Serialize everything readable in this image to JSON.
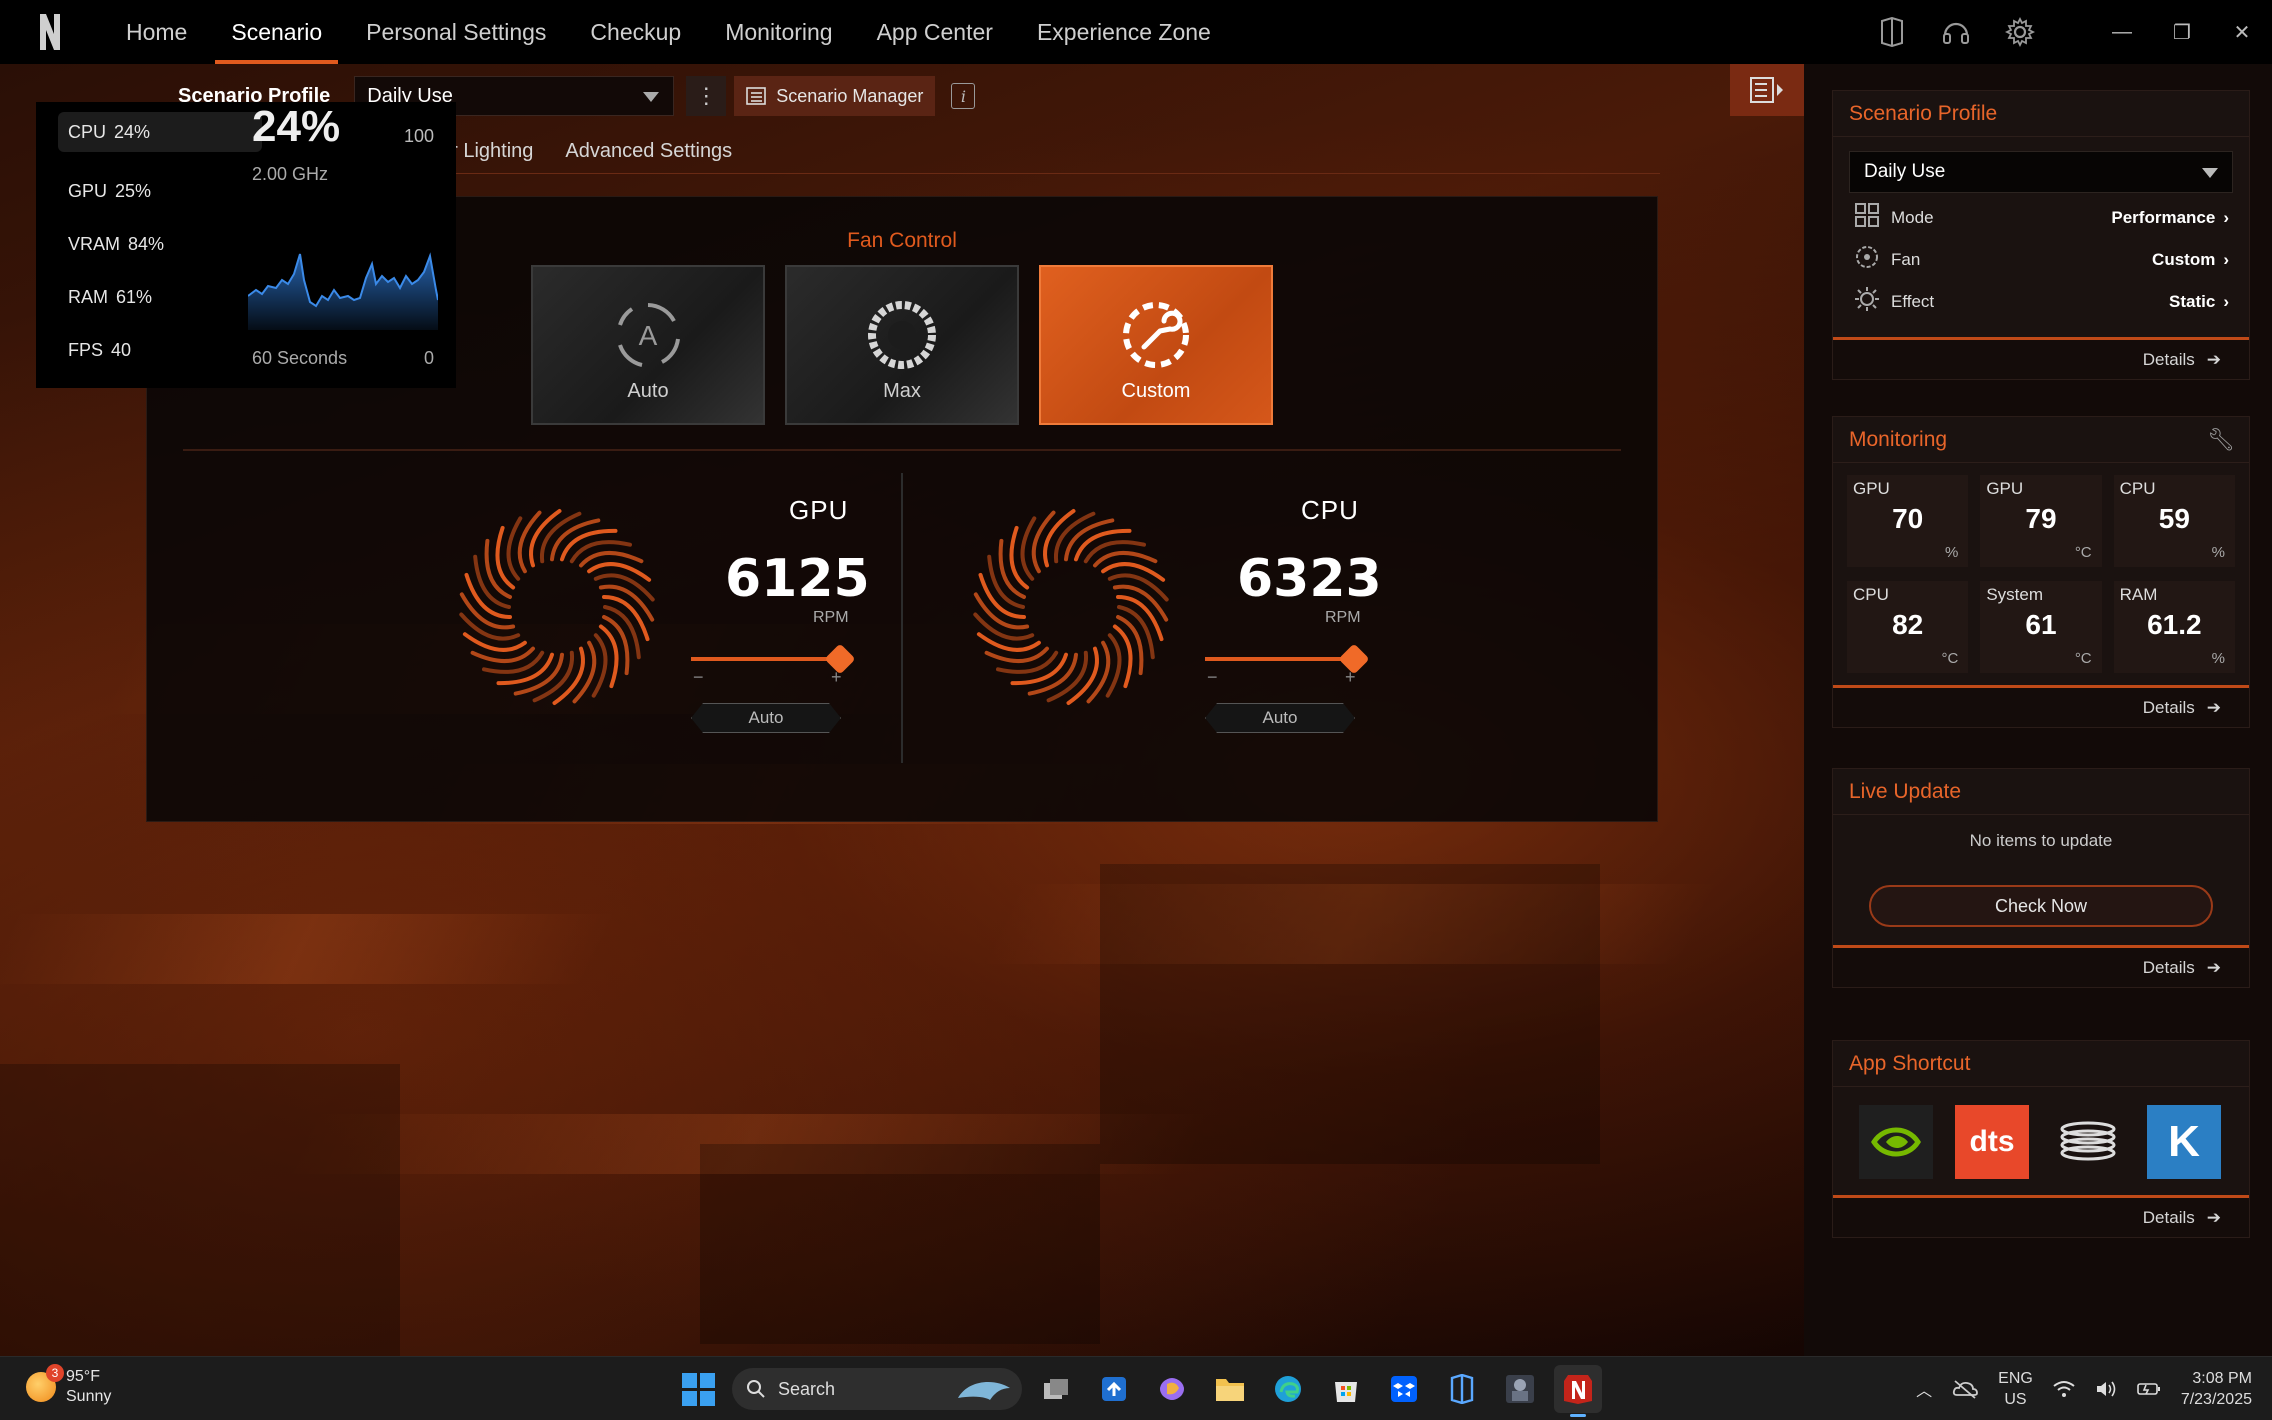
{
  "nav": {
    "items": [
      "Home",
      "Scenario",
      "Personal Settings",
      "Checkup",
      "Monitoring",
      "App Center",
      "Experience Zone"
    ],
    "active_index": 1
  },
  "scenario_bar": {
    "label": "Scenario Profile",
    "selected": "Daily Use",
    "manager_label": "Scenario Manager",
    "info_glyph": "i"
  },
  "subtabs": [
    "ar Lighting",
    "Advanced Settings"
  ],
  "fan_control": {
    "title": "Fan Control",
    "modes": [
      {
        "label": "Auto",
        "icon": "fan-auto-icon",
        "active": false
      },
      {
        "label": "Max",
        "icon": "fan-max-icon",
        "active": false
      },
      {
        "label": "Custom",
        "icon": "fan-custom-icon",
        "active": true
      }
    ],
    "gpu": {
      "name": "GPU",
      "rpm": "6125",
      "unit": "RPM",
      "level": 1.0,
      "minus": "−",
      "plus": "+",
      "auto_label": "Auto"
    },
    "cpu": {
      "name": "CPU",
      "rpm": "6323",
      "unit": "RPM",
      "level": 1.0,
      "minus": "−",
      "plus": "+",
      "auto_label": "Auto"
    }
  },
  "perf_overlay": {
    "items": [
      {
        "name": "CPU",
        "value": "24%"
      },
      {
        "name": "GPU",
        "value": "25%"
      },
      {
        "name": "VRAM",
        "value": "84%"
      },
      {
        "name": "RAM",
        "value": "61%"
      },
      {
        "name": "FPS",
        "value": "40"
      }
    ],
    "big_value": "24%",
    "max": "100",
    "freq": "2.00 GHz",
    "x_left": "60 Seconds",
    "x_right": "0",
    "graph_color": "#2f7bd8"
  },
  "sidebar": {
    "profile": {
      "title": "Scenario Profile",
      "selected": "Daily Use",
      "rows": [
        {
          "name": "Mode",
          "value": "Performance",
          "icon": "grid-icon"
        },
        {
          "name": "Fan",
          "value": "Custom",
          "icon": "fan-icon"
        },
        {
          "name": "Effect",
          "value": "Static",
          "icon": "sun-icon"
        }
      ],
      "details": "Details"
    },
    "monitoring": {
      "title": "Monitoring",
      "cells": [
        {
          "label": "GPU",
          "value": "70",
          "unit": "%"
        },
        {
          "label": "GPU",
          "value": "79",
          "unit": "°C"
        },
        {
          "label": "CPU",
          "value": "59",
          "unit": "%"
        },
        {
          "label": "CPU",
          "value": "82",
          "unit": "°C"
        },
        {
          "label": "System",
          "value": "61",
          "unit": "°C"
        },
        {
          "label": "RAM",
          "value": "61.2",
          "unit": "%"
        }
      ],
      "details": "Details"
    },
    "live_update": {
      "title": "Live Update",
      "empty": "No items to update",
      "button": "Check Now",
      "details": "Details"
    },
    "app_shortcut": {
      "title": "App Shortcut",
      "apps": [
        {
          "icon": "nvidia-icon"
        },
        {
          "icon": "dts-icon",
          "text": "dts"
        },
        {
          "icon": "ring-app-icon"
        },
        {
          "icon": "k-app-icon",
          "text": "K"
        }
      ],
      "details": "Details"
    }
  },
  "taskbar": {
    "weather_temp": "95°F",
    "weather_desc": "Sunny",
    "weather_badge": "3",
    "search_placeholder": "Search",
    "lang_top": "ENG",
    "lang_bottom": "US",
    "time": "3:08 PM",
    "date": "7/23/2025"
  },
  "colors": {
    "accent": "#e05a1e",
    "accent_light": "#f06a28",
    "background": "#0b0504"
  }
}
